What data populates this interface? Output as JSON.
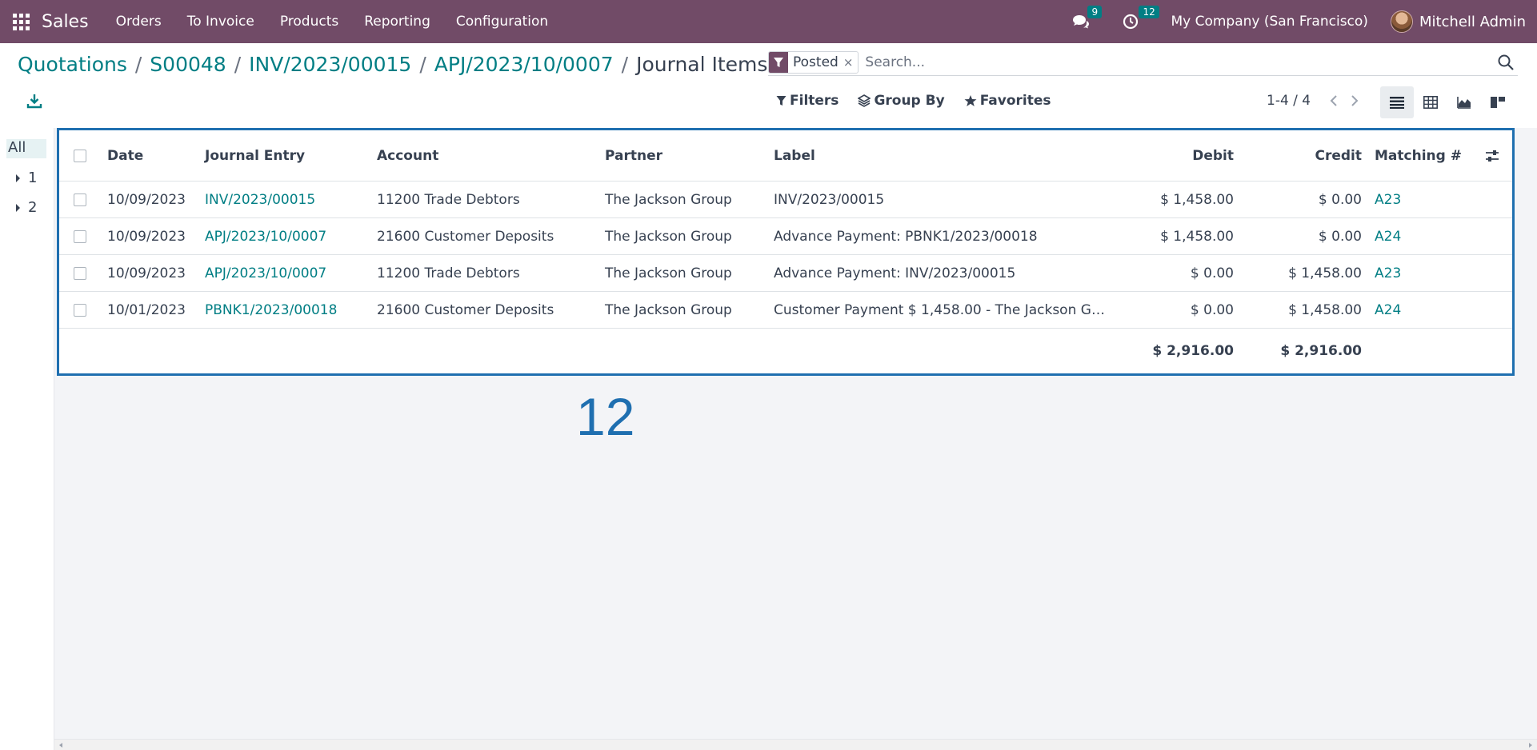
{
  "navbar": {
    "app_name": "Sales",
    "menu": [
      "Orders",
      "To Invoice",
      "Products",
      "Reporting",
      "Configuration"
    ],
    "messages_count": "9",
    "activities_count": "12",
    "company": "My Company (San Francisco)",
    "user": "Mitchell Admin"
  },
  "breadcrumb": {
    "items": [
      "Quotations",
      "S00048",
      "INV/2023/00015",
      "APJ/2023/10/0007"
    ],
    "separator": "/",
    "current": "Journal Items"
  },
  "search": {
    "facet_label": "Posted",
    "facet_remove": "×",
    "placeholder": "Search..."
  },
  "filters": {
    "filters_label": "Filters",
    "group_by_label": "Group By",
    "favorites_label": "Favorites"
  },
  "pager": {
    "value": "1-4 / 4"
  },
  "left_panel": {
    "all_label": "All",
    "groups": [
      "1",
      "2"
    ]
  },
  "table": {
    "columns": {
      "date": "Date",
      "entry": "Journal Entry",
      "account": "Account",
      "partner": "Partner",
      "label": "Label",
      "debit": "Debit",
      "credit": "Credit",
      "matching": "Matching #"
    },
    "rows": [
      {
        "date": "10/09/2023",
        "entry": "INV/2023/00015",
        "account": "11200 Trade Debtors",
        "partner": "The Jackson Group",
        "label": "INV/2023/00015",
        "debit": "$ 1,458.00",
        "credit": "$ 0.00",
        "matching": "A23"
      },
      {
        "date": "10/09/2023",
        "entry": "APJ/2023/10/0007",
        "account": "21600 Customer Deposits",
        "partner": "The Jackson Group",
        "label": "Advance Payment: PBNK1/2023/00018",
        "debit": "$ 1,458.00",
        "credit": "$ 0.00",
        "matching": "A24"
      },
      {
        "date": "10/09/2023",
        "entry": "APJ/2023/10/0007",
        "account": "11200 Trade Debtors",
        "partner": "The Jackson Group",
        "label": "Advance Payment: INV/2023/00015",
        "debit": "$ 0.00",
        "credit": "$ 1,458.00",
        "matching": "A23"
      },
      {
        "date": "10/01/2023",
        "entry": "PBNK1/2023/00018",
        "account": "21600 Customer Deposits",
        "partner": "The Jackson Group",
        "label": "Customer Payment $ 1,458.00 - The Jackson Grou…",
        "debit": "$ 0.00",
        "credit": "$ 1,458.00",
        "matching": "A24"
      }
    ],
    "totals": {
      "debit": "$ 2,916.00",
      "credit": "$ 2,916.00"
    }
  },
  "annotation": {
    "number": "12"
  },
  "colors": {
    "brand": "#714b67",
    "link": "#017e84",
    "highlight_border": "#1f6fb0"
  }
}
